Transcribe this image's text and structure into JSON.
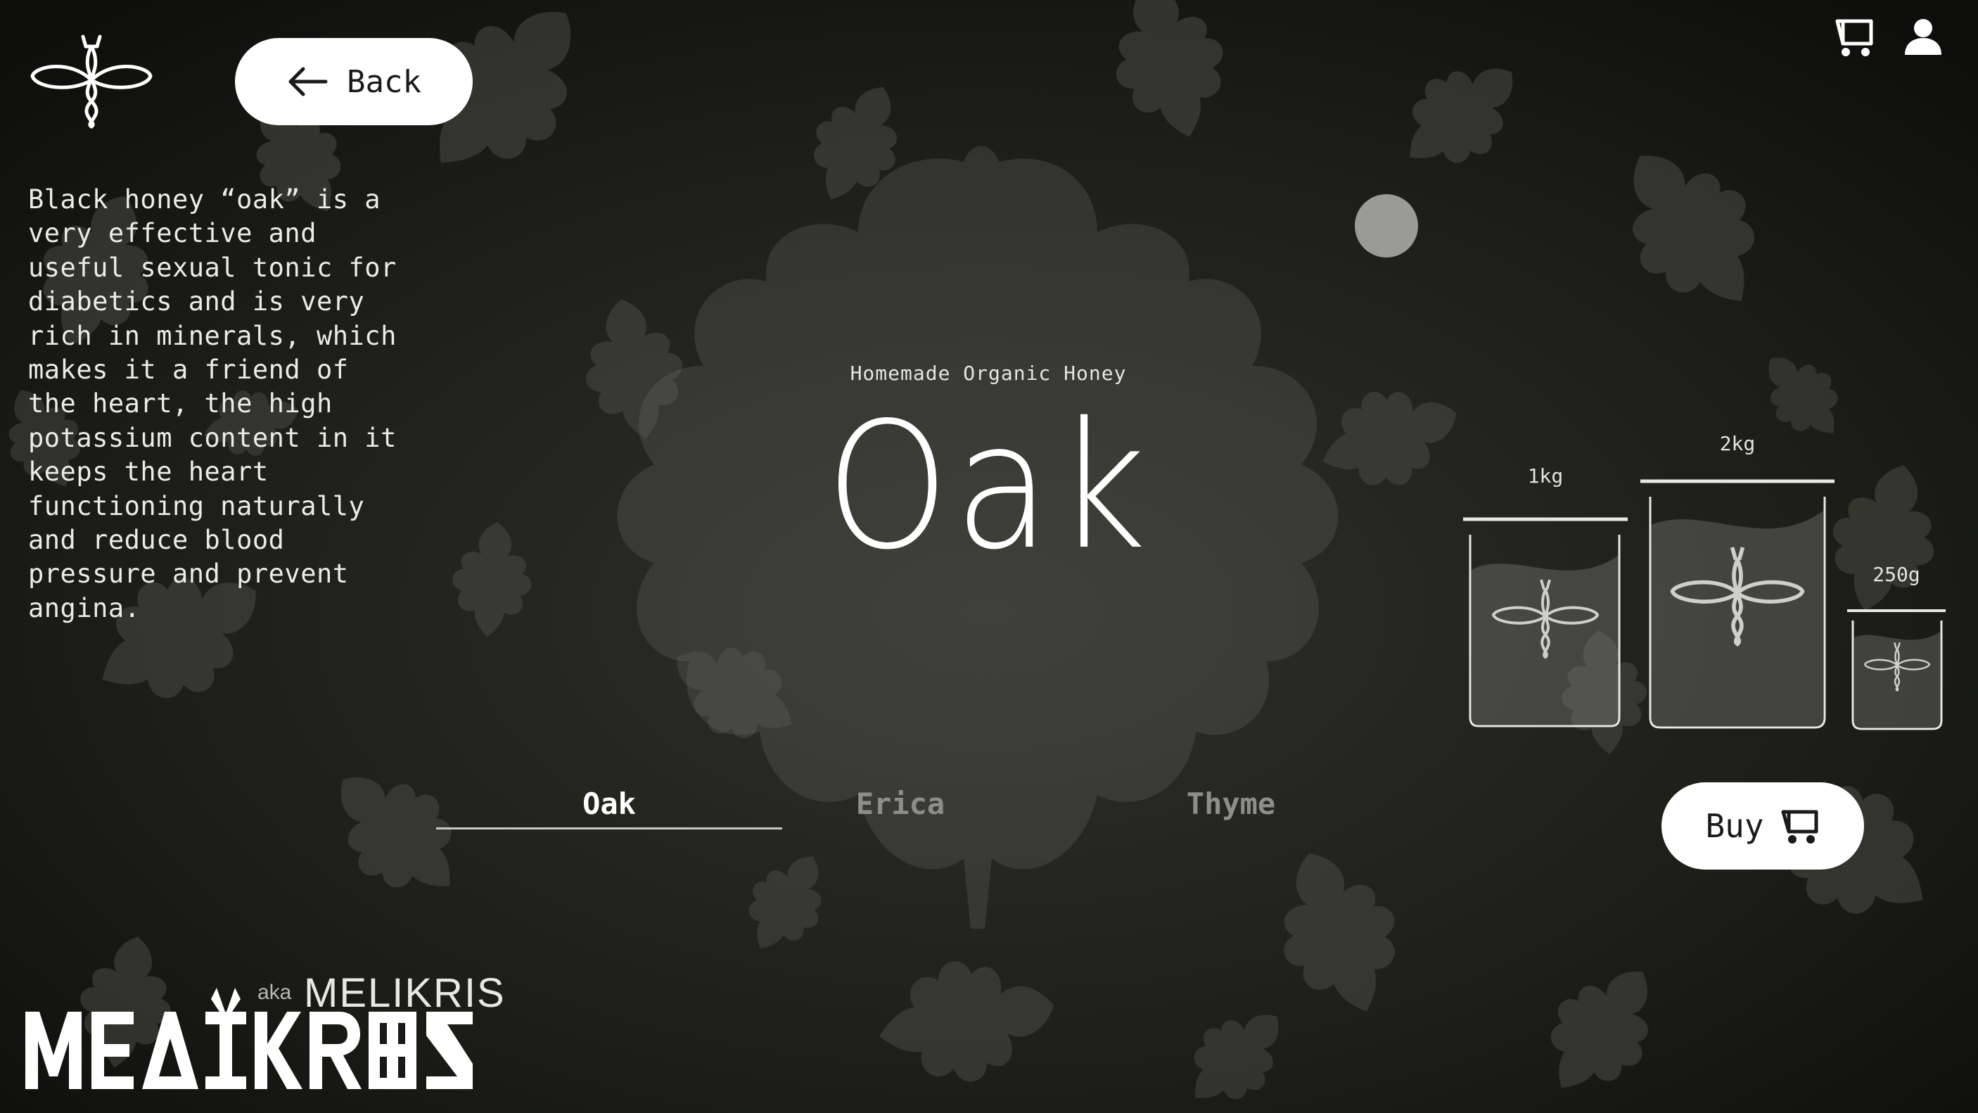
{
  "header": {
    "back_label": "Back",
    "icons": [
      "logo-icon",
      "arrow-left-icon",
      "cart-icon",
      "user-icon"
    ]
  },
  "description": "Black honey “oak” is a\nvery effective and\nuseful sexual tonic for\ndiabetics and is very\nrich in minerals, which\nmakes it a friend of\nthe heart, the high\npotassium content in it\nkeeps the heart\nfunctioning naturally\nand reduce blood\npressure and prevent\nangina.",
  "product": {
    "subtitle": "Homemade Organic Honey",
    "name": "Oak"
  },
  "tabs": [
    {
      "label": "Oak",
      "active": true
    },
    {
      "label": "Erica",
      "active": false
    },
    {
      "label": "Thyme",
      "active": false
    }
  ],
  "sizes": [
    {
      "label": "1kg"
    },
    {
      "label": "2kg"
    },
    {
      "label": "250g"
    }
  ],
  "buy_label": "Buy",
  "brand": {
    "wordmark": "MELIKRIS",
    "aka": "aka",
    "aka_name": "MELIKRIS"
  },
  "colors": {
    "background": "#1a1b16",
    "button_bg": "#ffffff",
    "text": "#f2f2ee",
    "inactive_tab": "#8e8e88"
  }
}
